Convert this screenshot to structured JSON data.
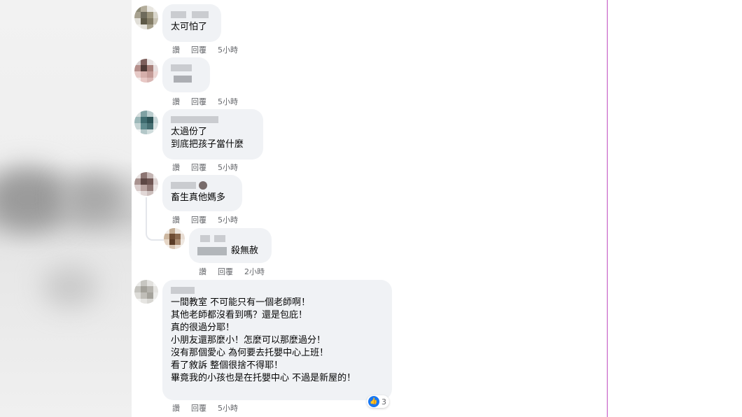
{
  "actions": {
    "like": "讚",
    "reply": "回覆"
  },
  "comments": [
    {
      "lines": [
        "太可怕了"
      ],
      "time": "5小時"
    },
    {
      "lines": [],
      "time": "5小時"
    },
    {
      "lines": [
        "太過份了",
        "到底把孩子當什麼"
      ],
      "time": "5小時"
    },
    {
      "lines": [
        "畜生真他媽多"
      ],
      "time": "5小時"
    },
    {
      "lines": [
        "殺無赦"
      ],
      "time": "2小時"
    },
    {
      "lines": [
        "一間教室 不可能只有一個老師啊！",
        "其他老師都沒看到嗎？還是包庇！",
        "真的很過分耶！",
        "小朋友還那麼小！怎麼可以那麼過分！",
        "沒有那個愛心 為何要去托嬰中心上班！",
        "看了敘訴 整個很捨不得耶！",
        "畢竟我的小孩也是在托嬰中心 不過是新屋的！"
      ],
      "time": "5小時",
      "reaction_count": "3"
    }
  ],
  "colors": {
    "bubble": "#f0f2f5",
    "meta": "#65676b",
    "like_blue": "#1877f2",
    "text": "#050505"
  },
  "icons": {
    "reaction": "thumbs-up-icon"
  }
}
